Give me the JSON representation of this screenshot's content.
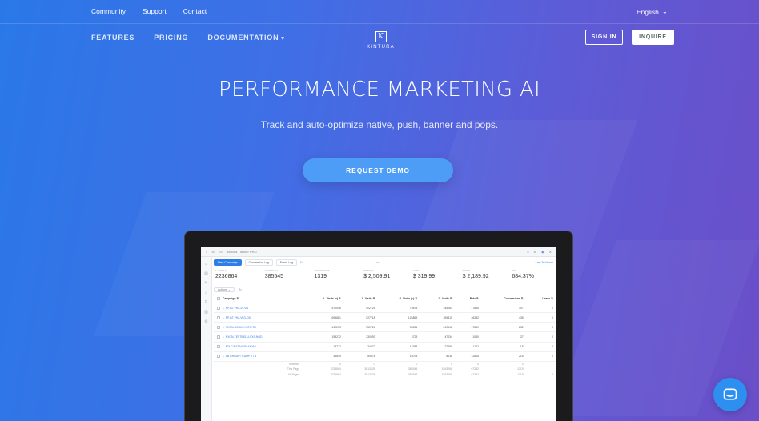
{
  "topbar": {
    "links": [
      "Community",
      "Support",
      "Contact"
    ],
    "language": "English"
  },
  "nav": {
    "features": "FEATURES",
    "pricing": "PRICING",
    "documentation": "DOCUMENTATION",
    "logo_letter": "K",
    "logo_name": "KINTURA",
    "sign_in": "SIGN IN",
    "inquire": "INQUIRE"
  },
  "hero": {
    "title": "PERFORMANCE MARKETING AI",
    "subtitle": "Track and auto-optimize native, push, banner and pops.",
    "cta": "REQUEST DEMO"
  },
  "app": {
    "window_title": "Kintura Tracker PRO",
    "tabs": [
      "New Campaign",
      "Conversion Log",
      "Event Log"
    ],
    "date_range": "Last 30 Hours",
    "kpis": [
      {
        "label": "L. Visits (u)",
        "value": "2236864"
      },
      {
        "label": "O. Visits (u)",
        "value": "385545"
      },
      {
        "label": "Conversions",
        "value": "1319"
      },
      {
        "label": "Revenue",
        "value": "$ 2,509.91"
      },
      {
        "label": "Cost",
        "value": "$ 319.99"
      },
      {
        "label": "Profit",
        "value": "$ 2,189.92"
      },
      {
        "label": "ROI",
        "value": "684.37%"
      }
    ],
    "actions_label": "Actions",
    "columns": [
      "Campaign",
      "L. Visits (u)",
      "L. Visits",
      "O. Visits (u)",
      "O. Visits",
      "Bids",
      "Conversions",
      "Leads"
    ],
    "rows": [
      {
        "name": "PP-BT PH2-29-VN",
        "values": [
          "570006",
          "902725",
          "79873",
          "245283",
          "17855",
          "307",
          "0"
        ]
      },
      {
        "name": "PP-BT PH2-VLD-CB",
        "values": [
          "695881",
          "927718",
          "125869",
          "395815",
          "26332",
          "435",
          "0"
        ]
      },
      {
        "name": "NXON-DS-JULY-STO-TH",
        "values": [
          "412293",
          "550724",
          "39834",
          "249618",
          "17849",
          "232",
          "0"
        ]
      },
      {
        "name": "NXON-TESTING-LLVXS-NOD",
        "values": [
          "193272",
          "230093",
          "4729",
          "47034",
          "1080",
          "27",
          "0"
        ]
      },
      {
        "name": "FOLC/DATING/SL4A0/Hi",
        "values": "18777|24372|12383|27256|1142|15|0"
      },
      {
        "name": "AB GROUP / CAMP 0 TB",
        "values": [
          "35849",
          "59478",
          "15078",
          "8038",
          "12615",
          "215",
          "0"
        ]
      }
    ],
    "summary": [
      {
        "label": "Selected",
        "values": [
          "0",
          "0",
          "0",
          "0",
          "0",
          "0",
          ""
        ]
      },
      {
        "label": "This Page",
        "values": [
          "2236864",
          "3613628",
          "385545",
          "1563268",
          "67332",
          "1319",
          ""
        ]
      },
      {
        "label": "All Pages",
        "values": [
          "2236864",
          "3613628",
          "385545",
          "1563268",
          "67332",
          "1319",
          "0"
        ]
      }
    ]
  },
  "colors": {
    "cta": "#4d9cf5",
    "chat": "#2d8ff0",
    "accent": "#2f7ee8"
  }
}
